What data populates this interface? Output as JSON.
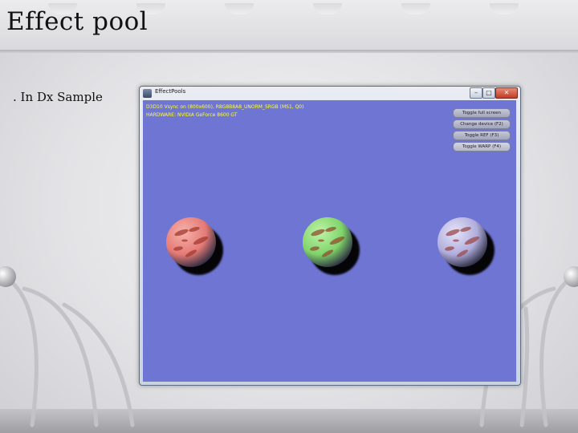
{
  "slide": {
    "title": "Effect pool",
    "bullet": ". In Dx Sample"
  },
  "window": {
    "title": "EffectPools",
    "controls": {
      "minimize": "–",
      "maximize": "□",
      "close": "✕"
    },
    "client_color": "#6f75d3",
    "stats": [
      "D3D10 Vsync on (800x600), R8G8B8A8_UNORM_SRGB (MS1, Q0)",
      "HARDWARE: NVIDIA GeForce 8600 GT"
    ],
    "buttons": [
      "Toggle full screen",
      "Change device (F2)",
      "Toggle REF (F3)",
      "Toggle WARP (F4)"
    ],
    "spheres": [
      {
        "name": "red",
        "base": "#e57a76",
        "light": "#f6b2ab",
        "spot": "#a2392f"
      },
      {
        "name": "green",
        "base": "#7fd46a",
        "light": "#bff3a8",
        "spot": "#8e4e2e"
      },
      {
        "name": "lavender",
        "base": "#b0addc",
        "light": "#e5e3fa",
        "spot": "#9a4a4a"
      }
    ]
  }
}
